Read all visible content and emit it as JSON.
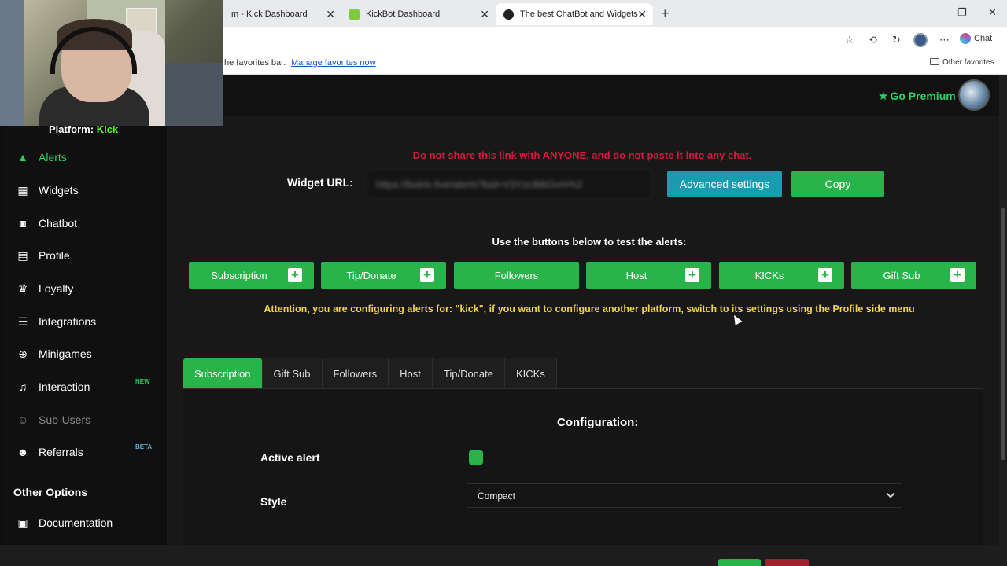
{
  "browser": {
    "tabs": [
      {
        "title": "m - Kick Dashboard"
      },
      {
        "title": "KickBot Dashboard"
      },
      {
        "title": "The best ChatBot and Widgets for"
      }
    ],
    "chat_label": "Chat",
    "favbar_text": "he favorites bar.",
    "favbar_link": "Manage favorites now",
    "other_favorites": "Other favorites"
  },
  "header": {
    "premium_label": "Go Premium"
  },
  "sidebar": {
    "platform_label": "Platform:",
    "platform_value": "Kick",
    "items": [
      {
        "label": "Alerts",
        "icon": "warning-triangle-icon"
      },
      {
        "label": "Widgets",
        "icon": "grid-icon"
      },
      {
        "label": "Chatbot",
        "icon": "robot-icon"
      },
      {
        "label": "Profile",
        "icon": "id-card-icon"
      },
      {
        "label": "Loyalty",
        "icon": "trophy-icon"
      },
      {
        "label": "Integrations",
        "icon": "list-icon"
      },
      {
        "label": "Minigames",
        "icon": "gamepad-icon"
      },
      {
        "label": "Interaction",
        "icon": "music-icon",
        "badge": "NEW"
      },
      {
        "label": "Sub-Users",
        "icon": "users-icon"
      },
      {
        "label": "Referrals",
        "icon": "users-icon",
        "badge": "BETA"
      },
      {
        "label": "Documentation",
        "icon": "book-icon"
      }
    ],
    "other_options": "Other Options"
  },
  "main": {
    "warning": "Do not share this link with ANYONE, and do not paste it into any chat.",
    "widget_url_label": "Widget URL:",
    "widget_url_value": "https://botrix.live/alerts?bid=V3Yzc8i6Gvm%2",
    "advanced_settings": "Advanced settings",
    "copy": "Copy",
    "test_title": "Use the buttons below to test the alerts:",
    "test_buttons": [
      {
        "label": "Subscription"
      },
      {
        "label": "Tip/Donate"
      },
      {
        "label": "Followers"
      },
      {
        "label": "Host"
      },
      {
        "label": "KICKs"
      },
      {
        "label": "Gift Sub"
      }
    ],
    "attention": "Attention, you are configuring alerts for: \"kick\", if you want to configure another platform, switch to its settings using the Profile side menu",
    "config_tabs": [
      "Subscription",
      "Gift Sub",
      "Followers",
      "Host",
      "Tip/Donate",
      "KICKs"
    ],
    "config_title": "Configuration:",
    "active_alert_label": "Active alert",
    "active_alert_checked": true,
    "style_label": "Style",
    "style_value": "Compact"
  },
  "colors": {
    "accent_green": "#28b44a",
    "kick_green": "#53fc18",
    "warning_red": "#d8183e",
    "attention_yellow": "#f0d24a",
    "advanced_blue": "#1a9cb0"
  }
}
